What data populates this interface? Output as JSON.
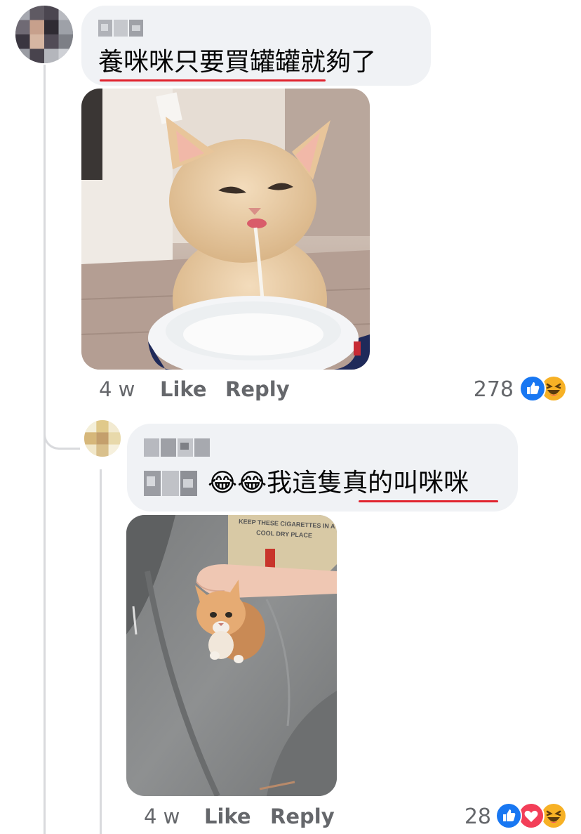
{
  "comments": [
    {
      "text_before": "",
      "text_underlined": "養咪咪只要買罐罐",
      "text_after": "就夠了",
      "time": "4 w",
      "like_label": "Like",
      "reply_label": "Reply",
      "reaction_count": "278",
      "reactions": [
        "like-icon",
        "haha-icon"
      ]
    },
    {
      "text_before": "😂😂我這隻",
      "text_underlined": "真的叫咪咪",
      "text_after": "",
      "time": "4 w",
      "like_label": "Like",
      "reply_label": "Reply",
      "reaction_count": "28",
      "reactions": [
        "like-icon",
        "love-icon",
        "haha-icon"
      ]
    }
  ],
  "colors": {
    "bubble": "#f0f2f5",
    "meta_text": "#65676b",
    "underline": "#e0232e",
    "like_blue": "#1877f2",
    "love_red": "#f33e58",
    "haha_yellow": "#f7b125"
  }
}
